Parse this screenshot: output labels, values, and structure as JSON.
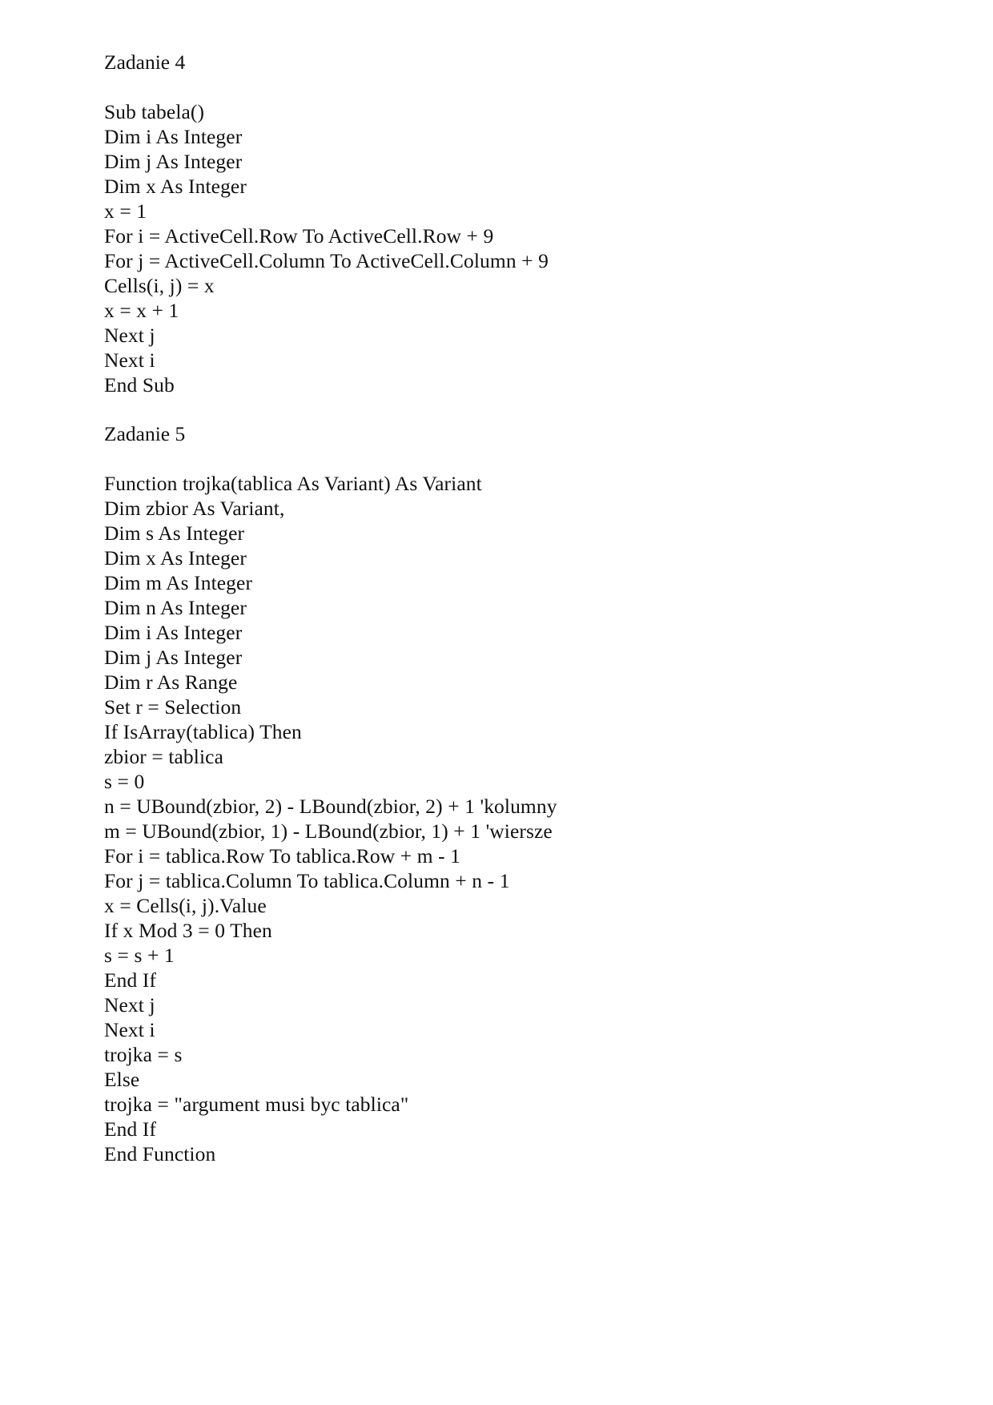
{
  "page": {
    "background_color": "#ffffff",
    "text_color": "#111111",
    "language": "pl"
  },
  "sections": [
    {
      "heading": "Zadanie 4",
      "code_lines": [
        "Sub tabela()",
        "Dim i As Integer",
        "Dim j As Integer",
        "Dim x As Integer",
        "x = 1",
        "For i = ActiveCell.Row To ActiveCell.Row + 9",
        "For j = ActiveCell.Column To ActiveCell.Column + 9",
        "Cells(i, j) = x",
        "x = x + 1",
        "Next j",
        "Next i",
        "End Sub"
      ]
    },
    {
      "heading": "Zadanie 5",
      "code_lines": [
        "Function trojka(tablica As Variant) As Variant",
        "Dim zbior As Variant,",
        "Dim s As Integer",
        "Dim x As Integer",
        "Dim m As Integer",
        "Dim n As Integer",
        "Dim i As Integer",
        "Dim j As Integer",
        "Dim r As Range",
        "Set r = Selection",
        "If IsArray(tablica) Then",
        "zbior = tablica",
        "s = 0",
        "n = UBound(zbior, 2) - LBound(zbior, 2) + 1 'kolumny",
        "m = UBound(zbior, 1) - LBound(zbior, 1) + 1 'wiersze",
        "For i = tablica.Row To tablica.Row + m - 1",
        "For j = tablica.Column To tablica.Column + n - 1",
        "x = Cells(i, j).Value",
        "If x Mod 3 = 0 Then",
        "s = s + 1",
        "End If",
        "Next j",
        "Next i",
        "trojka = s",
        "Else",
        "trojka = \"argument musi byc tablica\"",
        "End If",
        "End Function"
      ]
    }
  ]
}
